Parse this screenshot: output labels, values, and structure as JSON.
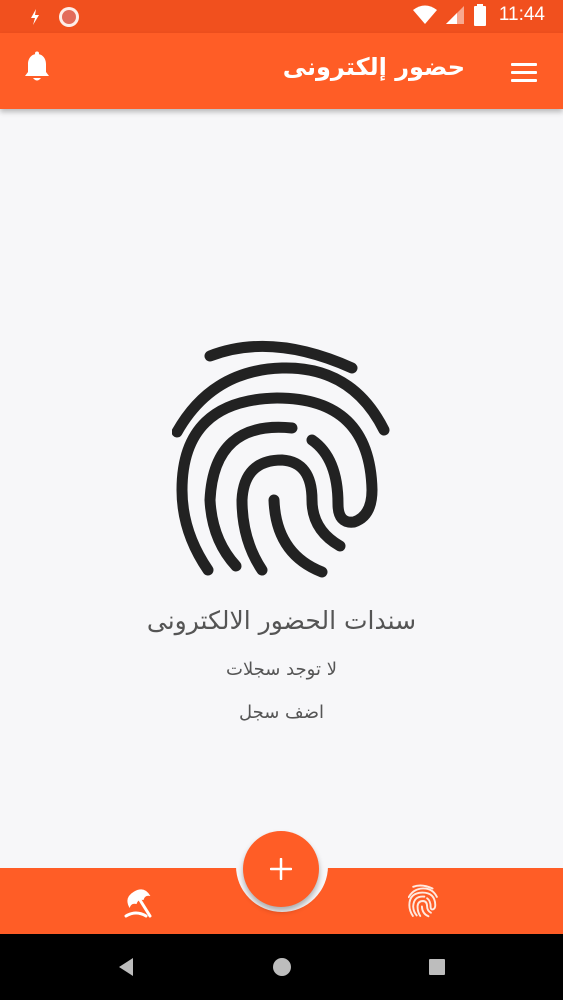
{
  "status_bar": {
    "time": "11:44",
    "icons": [
      "tethering-icon",
      "record-icon",
      "wifi-icon",
      "signal-icon",
      "battery-icon"
    ]
  },
  "app_bar": {
    "title": "حضور إلكترونى",
    "left_icon": "bell-icon",
    "right_icon": "menu-icon"
  },
  "empty_state": {
    "icon": "fingerprint-icon",
    "title": "سندات الحضور الالكترونى",
    "subtitle": "لا توجد سجلات",
    "action": "اضف سجل"
  },
  "bottom_nav": {
    "fab_icon": "plus-icon",
    "items": [
      {
        "icon": "vacation-umbrella-icon"
      },
      {
        "icon": "fingerprint-icon"
      }
    ]
  },
  "colors": {
    "primary": "#ff5d26",
    "status_bar": "#f1501e",
    "background": "#f7f7f9",
    "text": "#555555"
  }
}
